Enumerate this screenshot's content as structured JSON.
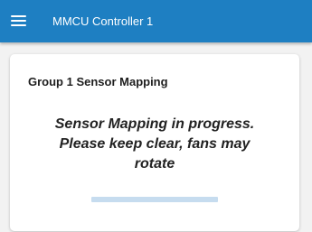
{
  "appbar": {
    "menu_icon": "hamburger-menu-icon",
    "title": "MMCU Controller 1",
    "color": "#1e7fc2"
  },
  "card": {
    "title": "Group 1 Sensor Mapping",
    "message_lines": [
      "Sensor Mapping in progress.",
      "Please keep clear, fans may",
      "rotate"
    ],
    "progress": {
      "indeterminate": true,
      "color": "#c6dcef"
    }
  }
}
